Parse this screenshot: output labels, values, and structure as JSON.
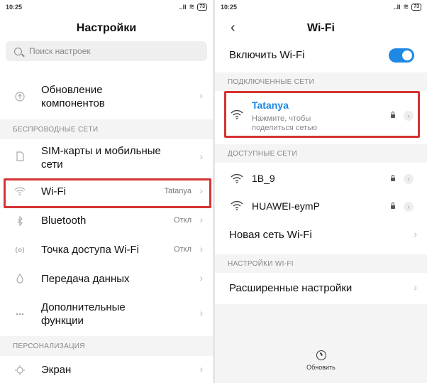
{
  "left": {
    "status": {
      "time": "10:25",
      "signal": "..ll",
      "wifi": "≋",
      "battery": "73"
    },
    "title": "Настройки",
    "search_placeholder": "Поиск настроек",
    "partial_item": "",
    "items_top": [
      {
        "label": "Обновление\nкомпонентов",
        "icon": "arrow-up-circle-icon"
      }
    ],
    "section_wireless": "БЕСПРОВОДНЫЕ СЕТИ",
    "wireless": [
      {
        "label": "SIM-карты и мобильные\nсети",
        "value": "",
        "icon": "sim-card-icon"
      },
      {
        "label": "Wi-Fi",
        "value": "Tatanya",
        "icon": "wifi-icon"
      },
      {
        "label": "Bluetooth",
        "value": "Откл",
        "icon": "bluetooth-icon"
      },
      {
        "label": "Точка доступа Wi-Fi",
        "value": "Откл",
        "icon": "hotspot-icon"
      },
      {
        "label": "Передача данных",
        "value": "",
        "icon": "data-usage-icon"
      },
      {
        "label": "Дополнительные\nфункции",
        "value": "",
        "icon": "more-functions-icon"
      }
    ],
    "section_personal": "ПЕРСОНАЛИЗАЦИЯ",
    "personal": [
      {
        "label": "Экран",
        "icon": "display-icon"
      }
    ]
  },
  "right": {
    "status": {
      "time": "10:25",
      "signal": "..ll",
      "wifi": "≋",
      "battery": "73"
    },
    "back": "‹",
    "title": "Wi-Fi",
    "enable_label": "Включить Wi-Fi",
    "enable_on": true,
    "section_connected": "ПОДКЛЮЧЕННЫЕ СЕТИ",
    "connected": {
      "name": "Tatanya",
      "sub": "Нажмите, чтобы\nподелиться сетью"
    },
    "section_available": "ДОСТУПНЫЕ СЕТИ",
    "available": [
      {
        "name": "1B_9"
      },
      {
        "name": "HUAWEI-eymP"
      }
    ],
    "new_network": "Новая сеть Wi-Fi",
    "section_settings": "НАСТРОЙКИ WI-FI",
    "advanced": "Расширенные настройки",
    "refresh": "Обновить"
  },
  "colors": {
    "accent": "#1e88e5",
    "highlight": "#d63232",
    "connected": "#1e88e5"
  }
}
